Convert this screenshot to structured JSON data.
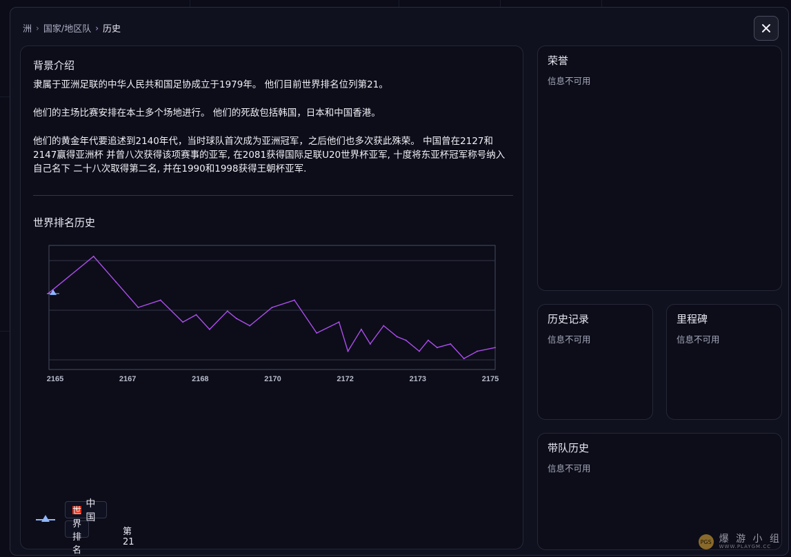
{
  "breadcrumb": {
    "root": "洲",
    "parent": "国家/地区队",
    "current": "历史"
  },
  "background": {
    "title": "背景介绍",
    "paragraphs": [
      "隶属于亚洲足联的中华人民共和国足协成立于1979年。 他们目前世界排名位列第21。",
      "他们的主场比赛安排在本土多个场地进行。 他们的死敌包括韩国，日本和中国香港。",
      "他们的黄金年代要追述到2140年代，当时球队首次成为亚洲冠军，之后他们也多次获此殊荣。 中国曾在2127和2147赢得亚洲杯 并曾八次获得该项赛事的亚军, 在2081获得国际足联U20世界杯亚军, 十度将东亚杯冠军称号纳入自己名下 二十八次取得第二名, 并在1990和1998获得王朝杯亚军."
    ]
  },
  "chart_title": "世界排名历史",
  "chart_data": {
    "type": "line",
    "x_tick_labels": [
      "2165",
      "2167",
      "2168",
      "2170",
      "2172",
      "2173",
      "2175"
    ],
    "x": [
      2165.0,
      2166.0,
      2166.5,
      2167.0,
      2167.5,
      2168.0,
      2168.3,
      2168.6,
      2169.0,
      2169.2,
      2169.5,
      2170.0,
      2170.5,
      2171.0,
      2171.5,
      2171.7,
      2172.0,
      2172.2,
      2172.5,
      2172.8,
      2173.0,
      2173.3,
      2173.5,
      2173.7,
      2174.0,
      2174.3,
      2174.6,
      2175.0
    ],
    "y": [
      25,
      15,
      22,
      29,
      27,
      33,
      31,
      35,
      30,
      32,
      34,
      29,
      27,
      36,
      33,
      41,
      35,
      39,
      34,
      37,
      38,
      41,
      38,
      40,
      39,
      43,
      41,
      40
    ],
    "ylim": [
      12,
      46
    ],
    "y_inverted": true,
    "line_color": "#b04df0"
  },
  "legend": {
    "country": "中国",
    "rank_label": "世界排名",
    "rank_value": "第21",
    "marker_color": "#8fb6ff"
  },
  "honors": {
    "title": "荣誉",
    "subtitle": "信息不可用"
  },
  "history": {
    "title": "历史记录",
    "subtitle": "信息不可用"
  },
  "milestones": {
    "title": "里程碑",
    "subtitle": "信息不可用"
  },
  "coaching": {
    "title": "带队历史",
    "subtitle": "信息不可用"
  },
  "watermark": {
    "text": "爆 游 小 组",
    "url": "WWW.PLAYGM.CC",
    "logo": "PGS"
  }
}
